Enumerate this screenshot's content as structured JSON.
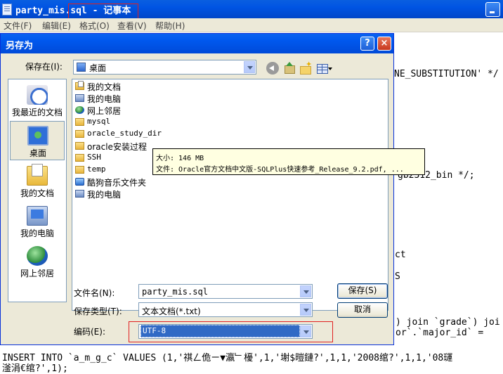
{
  "notepad": {
    "title": "party_mis.sql - 记事本",
    "menu": [
      "文件(F)",
      "编辑(E)",
      "格式(O)",
      "查看(V)",
      "帮助(H)"
    ],
    "text_fragments": {
      "l1": "NE_SUBSTITUTION' */",
      "l2": "gb2312_bin */;",
      "l3": "ct",
      "l4": "S",
      "l5": ") join `grade`) joi",
      "l6": "or`.`major_id` =",
      "l7": "INSERT INTO `a_m_g_c` VALUES (1,'祺ㄥ佹ㄧ▼瀛﹂櫌',1,'塮$暟鏈?',1,1,'2008绾?',1,1,'08璭",
      "l8": "滏涓€绾?',1);"
    }
  },
  "dialog": {
    "title": "另存为",
    "help_button": "?",
    "close_button": "×",
    "save_in_label": "保存在(I):",
    "save_in_value": "桌面",
    "places": [
      "我最近的文档",
      "桌面",
      "我的文档",
      "我的电脑",
      "网上邻居"
    ],
    "files": [
      {
        "name": "我的文档",
        "icon": "docs-folder-icon"
      },
      {
        "name": "我的电脑",
        "icon": "computer-icon"
      },
      {
        "name": "网上邻居",
        "icon": "network-icon"
      },
      {
        "name": "mysql",
        "icon": "folder-icon"
      },
      {
        "name": "oracle_study_dir",
        "icon": "folder-icon"
      },
      {
        "name": "oracle安装过程",
        "icon": "folder-icon"
      },
      {
        "name": "SSH",
        "icon": "folder-icon"
      },
      {
        "name": "temp",
        "icon": "folder-icon"
      },
      {
        "name": "酷狗音乐文件夹",
        "icon": "app-folder-icon"
      },
      {
        "name": "我的电脑",
        "icon": "computer-icon"
      }
    ],
    "tooltip": {
      "size": "大小: 146 MB",
      "file": "文件: Oracle官方文档中文版-SQLPlus快速参考_Release_9.2.pdf, ..."
    },
    "filename_label": "文件名(N):",
    "filename_value": "party_mis.sql",
    "filetype_label": "保存类型(T):",
    "filetype_value": "文本文档(*.txt)",
    "encoding_label": "编码(E):",
    "encoding_value": "UTF-8",
    "save_button": "保存(S)",
    "cancel_button": "取消"
  }
}
